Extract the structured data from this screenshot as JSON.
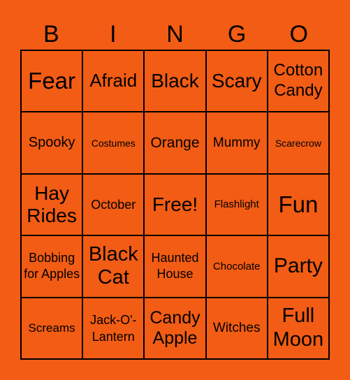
{
  "header": [
    "B",
    "I",
    "N",
    "G",
    "O"
  ],
  "cells": [
    "Fear",
    "Afraid",
    "Black",
    "Scary",
    "Cotton Candy",
    "Spooky",
    "Costumes",
    "Orange",
    "Mummy",
    "Scarecrow",
    "Hay Rides",
    "October",
    "Free!",
    "Flashlight",
    "Fun",
    "Bobbing for Apples",
    "Black Cat",
    "Haunted House",
    "Chocolate",
    "Party",
    "Screams",
    "Jack-O'-Lantern",
    "Candy Apple",
    "Witches",
    "Full Moon"
  ],
  "colors": {
    "background": "#F25C14",
    "border": "#000000",
    "text": "#000000"
  }
}
